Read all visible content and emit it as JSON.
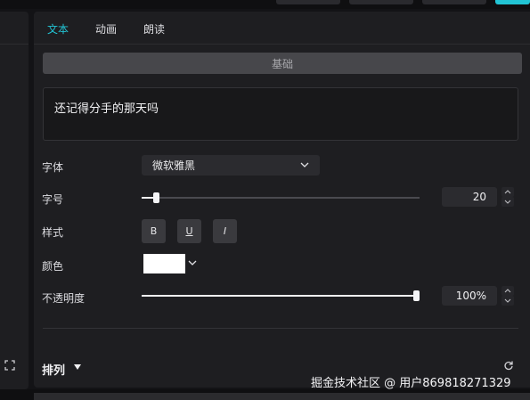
{
  "tabs": [
    {
      "label": "文本",
      "active": true
    },
    {
      "label": "动画",
      "active": false
    },
    {
      "label": "朗读",
      "active": false
    }
  ],
  "section": {
    "label": "基础"
  },
  "text_input": {
    "value": "还记得分手的那天吗"
  },
  "font": {
    "label": "字体",
    "value": "微软雅黑"
  },
  "font_size": {
    "label": "字号",
    "value": "20",
    "slider_fraction": 0.05
  },
  "style": {
    "label": "样式",
    "bold": "B",
    "underline": "U",
    "italic": "I"
  },
  "color": {
    "label": "颜色",
    "value": "#ffffff"
  },
  "opacity": {
    "label": "不透明度",
    "value": "100%",
    "slider_fraction": 1.0
  },
  "arrange": {
    "label": "排列"
  },
  "watermark": "掘金技术社区 @ 用户869818271329",
  "colors": {
    "accent": "#22c4d4",
    "panel": "#1e1e21",
    "background": "#131316"
  }
}
